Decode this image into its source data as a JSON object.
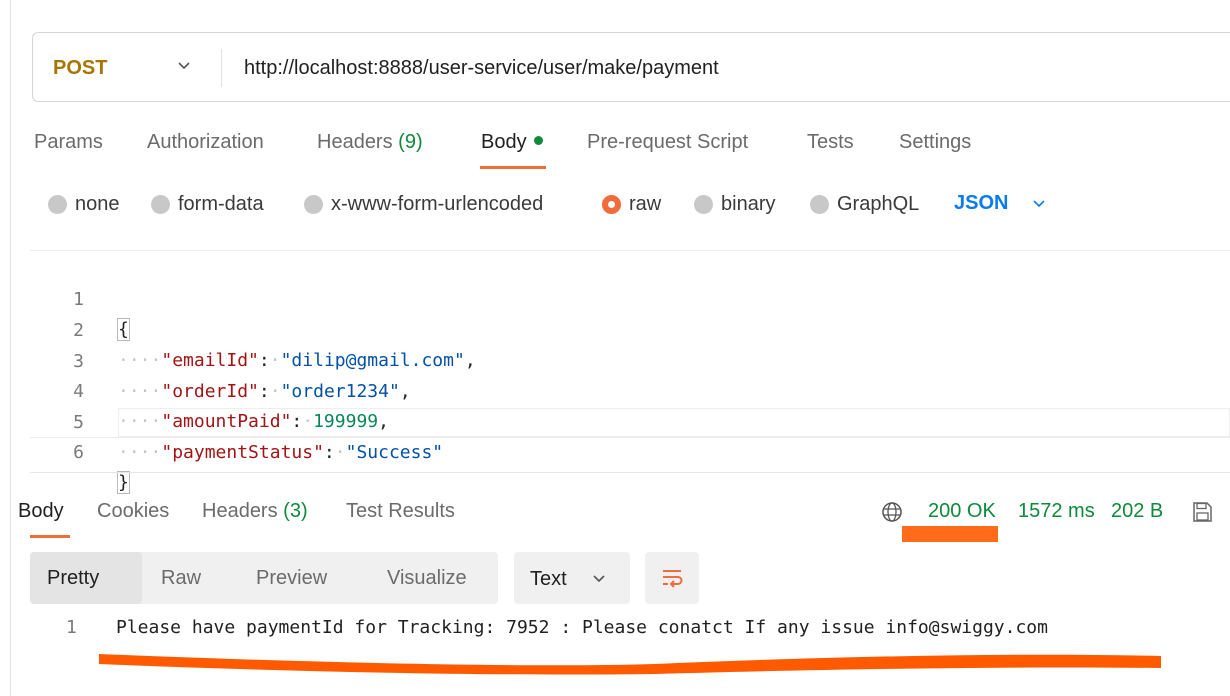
{
  "request": {
    "method": "POST",
    "url": "http://localhost:8888/user-service/user/make/payment"
  },
  "request_tabs": {
    "params": "Params",
    "authorization": "Authorization",
    "headers_label": "Headers",
    "headers_count": "(9)",
    "body": "Body",
    "pre_request": "Pre-request Script",
    "tests": "Tests",
    "settings": "Settings"
  },
  "body_types": {
    "none": "none",
    "form_data": "form-data",
    "urlencoded": "x-www-form-urlencoded",
    "raw": "raw",
    "binary": "binary",
    "graphql": "GraphQL",
    "selected": "raw",
    "format": "JSON"
  },
  "editor": {
    "line_numbers": [
      "1",
      "2",
      "3",
      "4",
      "5",
      "6"
    ],
    "open_brace": "{",
    "close_brace": "}",
    "fields": [
      {
        "key": "\"emailId\"",
        "value": "\"dilip@gmail.com\"",
        "comma": ","
      },
      {
        "key": "\"orderId\"",
        "value": "\"order1234\"",
        "comma": ","
      },
      {
        "key": "\"amountPaid\"",
        "value": "199999",
        "comma": ","
      },
      {
        "key": "\"paymentStatus\"",
        "value": "\"Success\"",
        "comma": ""
      }
    ],
    "indent_dots": "····",
    "colon": ":",
    "space_dot": "·"
  },
  "response_tabs": {
    "body": "Body",
    "cookies": "Cookies",
    "headers_label": "Headers",
    "headers_count": "(3)",
    "test_results": "Test Results"
  },
  "response_status": {
    "status": "200 OK",
    "time": "1572 ms",
    "size": "202 B"
  },
  "view_modes": {
    "pretty": "Pretty",
    "raw": "Raw",
    "preview": "Preview",
    "visualize": "Visualize",
    "format": "Text"
  },
  "response_body": {
    "line_number": "1",
    "text": "Please have paymentId for Tracking: 7952 : Please conatct If any issue info@swiggy.com"
  },
  "colors": {
    "accent": "#f26b3a",
    "success": "#0f8a3a",
    "link_blue": "#097bed",
    "annotation": "#ff6b1a"
  }
}
